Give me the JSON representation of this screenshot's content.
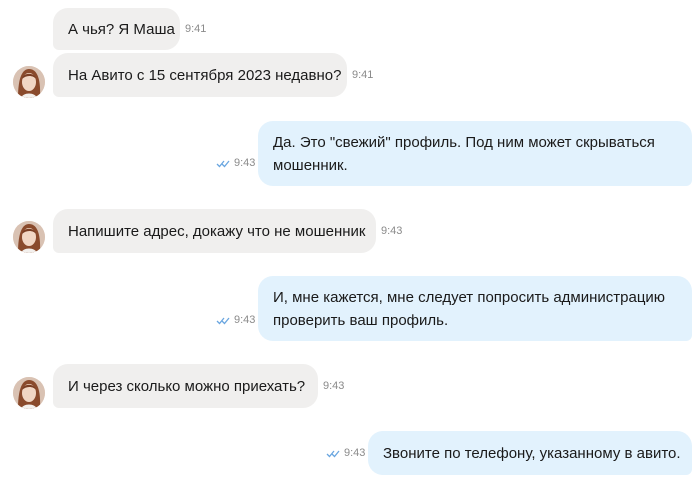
{
  "messages": [
    {
      "side": "in",
      "text": "А чья? Я Маша",
      "time": "9:41",
      "avatar": false
    },
    {
      "side": "in",
      "text": "На Авито с 15 сентября 2023 недавно?",
      "time": "9:41",
      "avatar": true
    },
    {
      "side": "out",
      "text": "Да. Это \"свежий\" профиль. Под ним может скрываться мошенник.",
      "time": "9:43",
      "status": "read"
    },
    {
      "side": "in",
      "text": "Напишите адрес, докажу что не мошенник",
      "time": "9:43",
      "avatar": true
    },
    {
      "side": "out",
      "text": "И, мне кажется, мне следует попросить администрацию проверить ваш профиль.",
      "time": "9:43",
      "status": "read"
    },
    {
      "side": "in",
      "text": "И через сколько можно приехать?",
      "time": "9:43",
      "avatar": true
    },
    {
      "side": "out",
      "text": "Звоните по телефону, указанному в авито.",
      "time": "9:43",
      "status": "read"
    }
  ],
  "colors": {
    "incoming_bubble": "#f0efee",
    "outgoing_bubble": "#e2f2fd",
    "read_ticks": "#6aa6e0",
    "time_text": "#8a8a8a"
  },
  "icons": {
    "read_status": "double-check-icon",
    "avatar": "user-avatar-photo"
  }
}
